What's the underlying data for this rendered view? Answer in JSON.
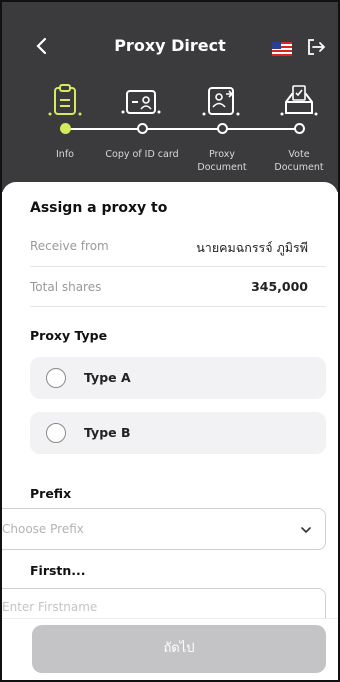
{
  "header": {
    "title": "Proxy Direct",
    "back_icon": "chevron-left-icon",
    "flag_icon": "us-flag-icon",
    "logout_icon": "logout-icon"
  },
  "steps": [
    {
      "label": "Info",
      "icon": "clipboard-icon",
      "active": true
    },
    {
      "label": "Copy of ID card",
      "icon": "id-card-icon",
      "active": false
    },
    {
      "label": "Proxy\nDocument",
      "icon": "proxy-document-icon",
      "active": false
    },
    {
      "label": "Vote\nDocument",
      "icon": "vote-box-icon",
      "active": false
    }
  ],
  "form": {
    "section_title": "Assign a proxy to",
    "receive_from_label": "Receive from",
    "receive_from_value": "นายคมฉกรรจ์ ภูมิรพี",
    "total_shares_label": "Total shares",
    "total_shares_value": "345,000",
    "proxy_type_title": "Proxy Type",
    "proxy_types": [
      "Type A",
      "Type B"
    ],
    "prefix_label": "Prefix",
    "prefix_placeholder": "Choose Prefix",
    "firstname_label": "Firstn...",
    "firstname_placeholder": "Enter Firstname"
  },
  "footer": {
    "next_label": "ถัดไป"
  },
  "colors": {
    "header_bg": "#3b3a3d",
    "accent": "#d7e95c",
    "button_disabled": "#c4c4c7"
  }
}
